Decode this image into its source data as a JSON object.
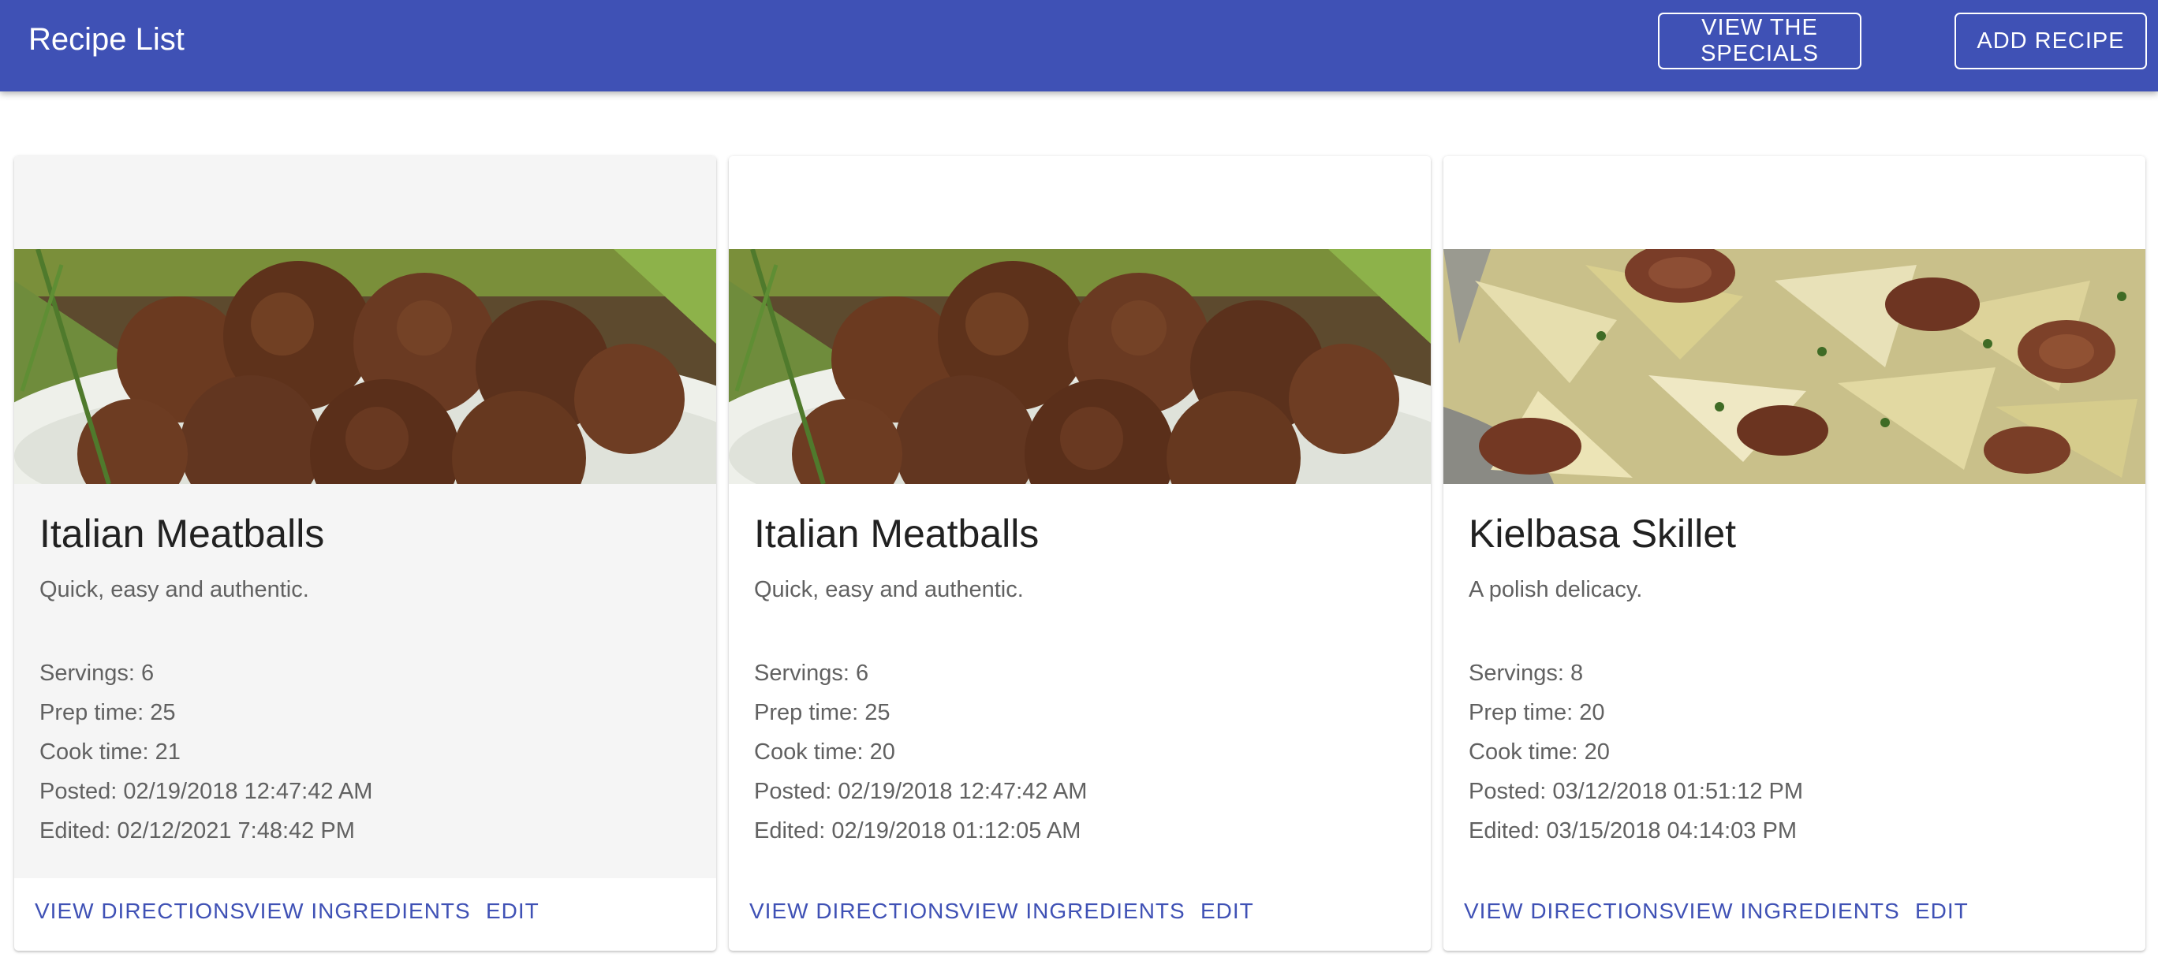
{
  "appbar": {
    "title": "Recipe List",
    "specials_label": "VIEW THE SPECIALS",
    "add_label": "ADD RECIPE",
    "color": "#3f51b5"
  },
  "cards": [
    {
      "title": "Italian Meatballs",
      "description": "Quick, easy and authentic.",
      "servings": "Servings: 6",
      "prep": "Prep time: 25",
      "cook": "Cook time: 21",
      "posted": "Posted: 02/19/2018 12:47:42 AM",
      "edited": "Edited: 02/12/2021 7:48:42 PM",
      "image": "meatballs-photo",
      "actions": {
        "directions": "VIEW DIRECTIONS",
        "ingredients": "VIEW INGREDIENTS",
        "edit": "EDIT"
      }
    },
    {
      "title": "Italian Meatballs",
      "description": "Quick, easy and authentic.",
      "servings": "Servings: 6",
      "prep": "Prep time: 25",
      "cook": "Cook time: 20",
      "posted": "Posted: 02/19/2018 12:47:42 AM",
      "edited": "Edited: 02/19/2018 01:12:05 AM",
      "image": "meatballs-photo",
      "actions": {
        "directions": "VIEW DIRECTIONS",
        "ingredients": "VIEW INGREDIENTS",
        "edit": "EDIT"
      }
    },
    {
      "title": "Kielbasa Skillet",
      "description": "A polish delicacy.",
      "servings": "Servings: 8",
      "prep": "Prep time: 20",
      "cook": "Cook time: 20",
      "posted": "Posted: 03/12/2018 01:51:12 PM",
      "edited": "Edited: 03/15/2018 04:14:03 PM",
      "image": "kielbasa-cabbage-photo",
      "actions": {
        "directions": "VIEW DIRECTIONS",
        "ingredients": "VIEW INGREDIENTS",
        "edit": "EDIT"
      }
    }
  ]
}
